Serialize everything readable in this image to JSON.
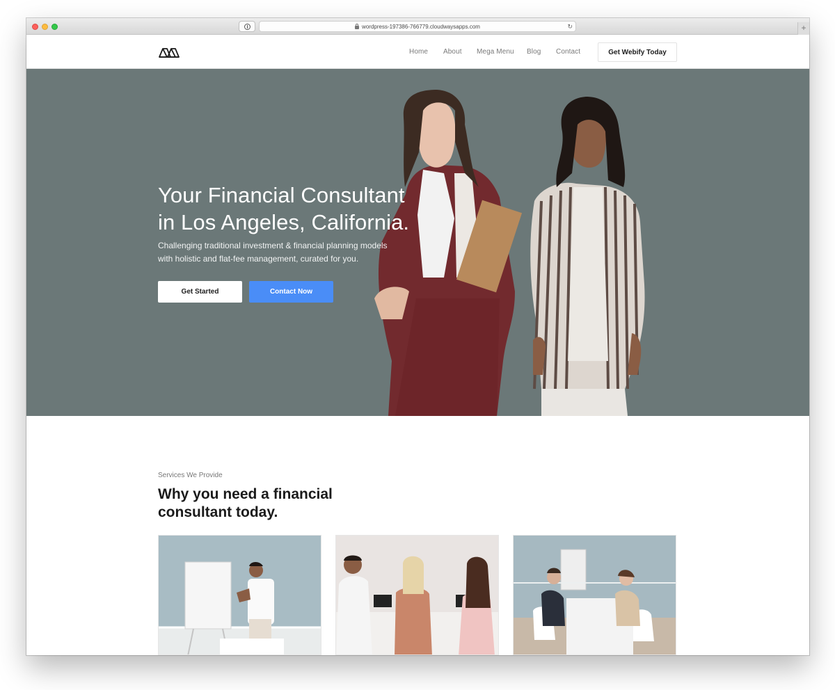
{
  "browser": {
    "url": "wordpress-197386-766779.cloudwaysapps.com",
    "newtab_label": "+"
  },
  "nav": {
    "items": [
      {
        "label": "Home"
      },
      {
        "label": "About"
      },
      {
        "label": "Mega Menu"
      },
      {
        "label": "Blog"
      },
      {
        "label": "Contact"
      }
    ],
    "cta_label": "Get Webify Today"
  },
  "hero": {
    "title_line1": "Your Financial Consultant",
    "title_line2": "in Los Angeles, California.",
    "subtitle_line1": "Challenging traditional investment & financial planning models",
    "subtitle_line2": "with holistic and flat-fee management, curated for you.",
    "primary_button": "Get Started",
    "secondary_button": "Contact Now",
    "background_color": "#6b7878",
    "accent_color": "#4a8df7"
  },
  "services": {
    "eyebrow": "Services We Provide",
    "title_line1": "Why you need a financial",
    "title_line2": "consultant today."
  },
  "icons": {
    "logo": "geometric-logo-icon",
    "lock": "lock-icon",
    "reload": "reload-icon",
    "privacy": "privacy-icon"
  }
}
